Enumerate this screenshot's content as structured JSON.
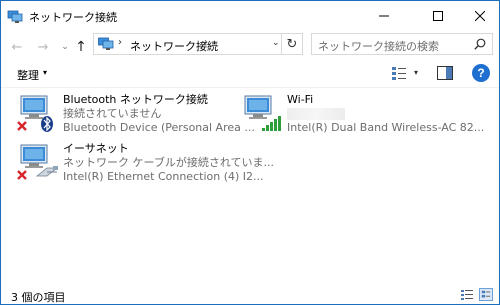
{
  "window": {
    "title": "ネットワーク接続",
    "minimize_symbol": "—",
    "maximize_symbol": "☐",
    "close_symbol": "✕"
  },
  "nav": {
    "back_symbol": "←",
    "forward_symbol": "→",
    "history_symbol": "⌄",
    "up_symbol": "↑"
  },
  "address": {
    "separator": "›",
    "path": "ネットワーク接続",
    "dropdown_symbol": "⌄",
    "refresh_symbol": "↻"
  },
  "search": {
    "placeholder": "ネットワーク接続の検索"
  },
  "command": {
    "organize_label": "整理",
    "organize_arrow": "▾",
    "view_arrow": "▾",
    "help_label": "?"
  },
  "items": [
    {
      "name": "Bluetooth ネットワーク接続",
      "status": "接続されていません",
      "device": "Bluetooth Device (Personal Area ...",
      "icon": "network-adapter-icon",
      "overlay": "bluetooth-icon",
      "state_badge": "red-x-icon"
    },
    {
      "name": "Wi-Fi",
      "status": "",
      "device": "Intel(R) Dual Band Wireless-AC 82...",
      "icon": "network-adapter-icon",
      "overlay": "wifi-signal-icon",
      "state_badge": ""
    },
    {
      "name": "イーサネット",
      "status": "ネットワーク ケーブルが接続されていま...",
      "device": "Intel(R) Ethernet Connection (4) I2...",
      "icon": "network-adapter-icon",
      "overlay": "ethernet-cable-icon",
      "state_badge": "red-x-icon"
    }
  ],
  "statusbar": {
    "item_count": "3 個の項目"
  },
  "colors": {
    "accent": "#1e6fd0",
    "window_border": "#1b6dbd",
    "error_red": "#d8262d",
    "signal_green": "#2e9f3a"
  }
}
